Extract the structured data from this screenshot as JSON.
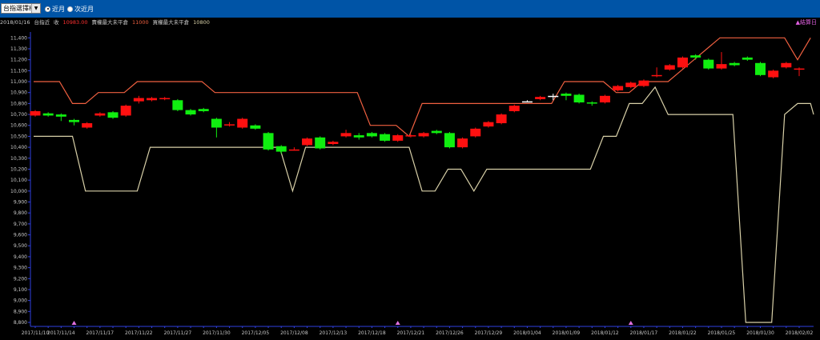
{
  "toolbar": {
    "select_value": "台指選擇權",
    "radio_current": "近月",
    "radio_next": "次近月"
  },
  "info": {
    "date": "2018/01/16",
    "index_label": "台指近",
    "close_label": "收",
    "close_value": "10983.00",
    "call_label": "賣權最大未平倉",
    "call_value": "11000",
    "put_label": "買權最大未平倉",
    "put_value": "10800",
    "settle_label": "▲結算日"
  },
  "colors": {
    "up": "#ff1010",
    "down": "#10ee10",
    "flat": "#ffffff",
    "call_line": "#f06040",
    "put_line": "#d8d0a8",
    "axis": "#3040e0"
  },
  "chart_data": {
    "type": "candlestick",
    "ylim": [
      8700,
      11500
    ],
    "yticks": [
      8800,
      8900,
      9000,
      9100,
      9200,
      9300,
      9400,
      9500,
      9600,
      9700,
      9800,
      9900,
      10000,
      10100,
      10200,
      10300,
      10400,
      10500,
      10600,
      10700,
      10800,
      10900,
      11000,
      11100,
      11200,
      11300,
      11400
    ],
    "x_tick_labels": [
      "2017/11/10",
      "2017/11/14",
      "2017/11/17",
      "2017/11/22",
      "2017/11/27",
      "2017/11/30",
      "2017/12/05",
      "2017/12/08",
      "2017/12/13",
      "2017/12/18",
      "2017/12/21",
      "2017/12/26",
      "2017/12/29",
      "2018/01/04",
      "2018/01/09",
      "2018/01/12",
      "2018/01/17",
      "2018/01/22",
      "2018/01/25",
      "2018/01/30",
      "2018/02/02"
    ],
    "x_tick_index": [
      0,
      2,
      5,
      8,
      11,
      14,
      17,
      20,
      23,
      26,
      29,
      32,
      35,
      38,
      41,
      44,
      47,
      50,
      53,
      56,
      59
    ],
    "settlement_marks": [
      3,
      28,
      46
    ],
    "candles": [
      {
        "o": 10690,
        "c": 10730,
        "h": 10740,
        "l": 10680
      },
      {
        "o": 10710,
        "c": 10690,
        "h": 10720,
        "l": 10680
      },
      {
        "o": 10700,
        "c": 10680,
        "h": 10710,
        "l": 10640
      },
      {
        "o": 10650,
        "c": 10630,
        "h": 10660,
        "l": 10600
      },
      {
        "o": 10580,
        "c": 10620,
        "h": 10630,
        "l": 10570
      },
      {
        "o": 10690,
        "c": 10710,
        "h": 10720,
        "l": 10680
      },
      {
        "o": 10720,
        "c": 10670,
        "h": 10730,
        "l": 10660
      },
      {
        "o": 10690,
        "c": 10780,
        "h": 10790,
        "l": 10680
      },
      {
        "o": 10820,
        "c": 10850,
        "h": 10870,
        "l": 10800
      },
      {
        "o": 10830,
        "c": 10850,
        "h": 10860,
        "l": 10820
      },
      {
        "o": 10840,
        "c": 10850,
        "h": 10860,
        "l": 10830
      },
      {
        "o": 10830,
        "c": 10740,
        "h": 10840,
        "l": 10730
      },
      {
        "o": 10740,
        "c": 10700,
        "h": 10750,
        "l": 10690
      },
      {
        "o": 10750,
        "c": 10730,
        "h": 10760,
        "l": 10720
      },
      {
        "o": 10660,
        "c": 10580,
        "h": 10670,
        "l": 10490
      },
      {
        "o": 10600,
        "c": 10610,
        "h": 10630,
        "l": 10590
      },
      {
        "o": 10580,
        "c": 10660,
        "h": 10670,
        "l": 10570
      },
      {
        "o": 10600,
        "c": 10570,
        "h": 10610,
        "l": 10560
      },
      {
        "o": 10530,
        "c": 10380,
        "h": 10540,
        "l": 10370
      },
      {
        "o": 10410,
        "c": 10360,
        "h": 10420,
        "l": 10340
      },
      {
        "o": 10370,
        "c": 10380,
        "h": 10400,
        "l": 10370
      },
      {
        "o": 10420,
        "c": 10480,
        "h": 10490,
        "l": 10410
      },
      {
        "o": 10490,
        "c": 10390,
        "h": 10500,
        "l": 10380
      },
      {
        "o": 10430,
        "c": 10450,
        "h": 10460,
        "l": 10420
      },
      {
        "o": 10500,
        "c": 10530,
        "h": 10560,
        "l": 10490
      },
      {
        "o": 10510,
        "c": 10490,
        "h": 10530,
        "l": 10470
      },
      {
        "o": 10530,
        "c": 10500,
        "h": 10540,
        "l": 10490
      },
      {
        "o": 10520,
        "c": 10460,
        "h": 10530,
        "l": 10450
      },
      {
        "o": 10460,
        "c": 10510,
        "h": 10520,
        "l": 10450
      },
      {
        "o": 10500,
        "c": 10510,
        "h": 10520,
        "l": 10490
      },
      {
        "o": 10500,
        "c": 10530,
        "h": 10540,
        "l": 10490
      },
      {
        "o": 10550,
        "c": 10530,
        "h": 10560,
        "l": 10520
      },
      {
        "o": 10530,
        "c": 10400,
        "h": 10540,
        "l": 10390
      },
      {
        "o": 10400,
        "c": 10480,
        "h": 10490,
        "l": 10390
      },
      {
        "o": 10500,
        "c": 10570,
        "h": 10580,
        "l": 10490
      },
      {
        "o": 10590,
        "c": 10630,
        "h": 10640,
        "l": 10580
      },
      {
        "o": 10620,
        "c": 10700,
        "h": 10710,
        "l": 10610
      },
      {
        "o": 10730,
        "c": 10780,
        "h": 10790,
        "l": 10720
      },
      {
        "o": 10820,
        "c": 10820,
        "h": 10830,
        "l": 10810
      },
      {
        "o": 10840,
        "c": 10860,
        "h": 10870,
        "l": 10830
      },
      {
        "o": 10870,
        "c": 10870,
        "h": 10890,
        "l": 10830
      },
      {
        "o": 10890,
        "c": 10870,
        "h": 10900,
        "l": 10830
      },
      {
        "o": 10880,
        "c": 10810,
        "h": 10890,
        "l": 10800
      },
      {
        "o": 10810,
        "c": 10800,
        "h": 10820,
        "l": 10780
      },
      {
        "o": 10810,
        "c": 10870,
        "h": 10880,
        "l": 10800
      },
      {
        "o": 10920,
        "c": 10960,
        "h": 10970,
        "l": 10910
      },
      {
        "o": 10950,
        "c": 10990,
        "h": 11000,
        "l": 10940
      },
      {
        "o": 10960,
        "c": 11010,
        "h": 11020,
        "l": 10950
      },
      {
        "o": 11050,
        "c": 11060,
        "h": 11130,
        "l": 11040
      },
      {
        "o": 11110,
        "c": 11150,
        "h": 11160,
        "l": 11100
      },
      {
        "o": 11130,
        "c": 11220,
        "h": 11230,
        "l": 11120
      },
      {
        "o": 11240,
        "c": 11220,
        "h": 11250,
        "l": 11200
      },
      {
        "o": 11200,
        "c": 11120,
        "h": 11210,
        "l": 11110
      },
      {
        "o": 11120,
        "c": 11160,
        "h": 11270,
        "l": 11110
      },
      {
        "o": 11170,
        "c": 11150,
        "h": 11180,
        "l": 11140
      },
      {
        "o": 11220,
        "c": 11200,
        "h": 11230,
        "l": 11190
      },
      {
        "o": 11170,
        "c": 11060,
        "h": 11180,
        "l": 11050
      },
      {
        "o": 11040,
        "c": 11100,
        "h": 11110,
        "l": 11030
      },
      {
        "o": 11130,
        "c": 11170,
        "h": 11180,
        "l": 11120
      },
      {
        "o": 11110,
        "c": 11120,
        "h": 11130,
        "l": 11050
      }
    ],
    "series": [
      {
        "name": "賣權最大未平倉",
        "values": [
          11000,
          11000,
          11000,
          10800,
          10800,
          10900,
          10900,
          10900,
          11000,
          11000,
          11000,
          11000,
          11000,
          11000,
          10900,
          10900,
          10900,
          10900,
          10900,
          10900,
          10900,
          10900,
          10900,
          10900,
          10900,
          10900,
          10600,
          10600,
          10600,
          10500,
          10800,
          10800,
          10800,
          10800,
          10800,
          10800,
          10800,
          10800,
          10800,
          10800,
          10800,
          11000,
          11000,
          11000,
          11000,
          10900,
          10900,
          11000,
          11000,
          11000,
          11100,
          11200,
          11300,
          11400,
          11400,
          11400,
          11400,
          11400,
          11400,
          11200,
          11400
        ]
      },
      {
        "name": "買權最大未平倉",
        "values": [
          10500,
          10500,
          10500,
          10500,
          10000,
          10000,
          10000,
          10000,
          10000,
          10400,
          10400,
          10400,
          10400,
          10400,
          10400,
          10400,
          10400,
          10400,
          10400,
          10400,
          10000,
          10400,
          10400,
          10400,
          10400,
          10400,
          10400,
          10400,
          10400,
          10400,
          10000,
          10000,
          10200,
          10200,
          10000,
          10200,
          10200,
          10200,
          10200,
          10200,
          10200,
          10200,
          10200,
          10200,
          10500,
          10500,
          10800,
          10800,
          10950,
          10700,
          10700,
          10700,
          10700,
          10700,
          10700,
          8800,
          8800,
          8800,
          10700,
          10800,
          10800,
          10700
        ]
      }
    ]
  }
}
